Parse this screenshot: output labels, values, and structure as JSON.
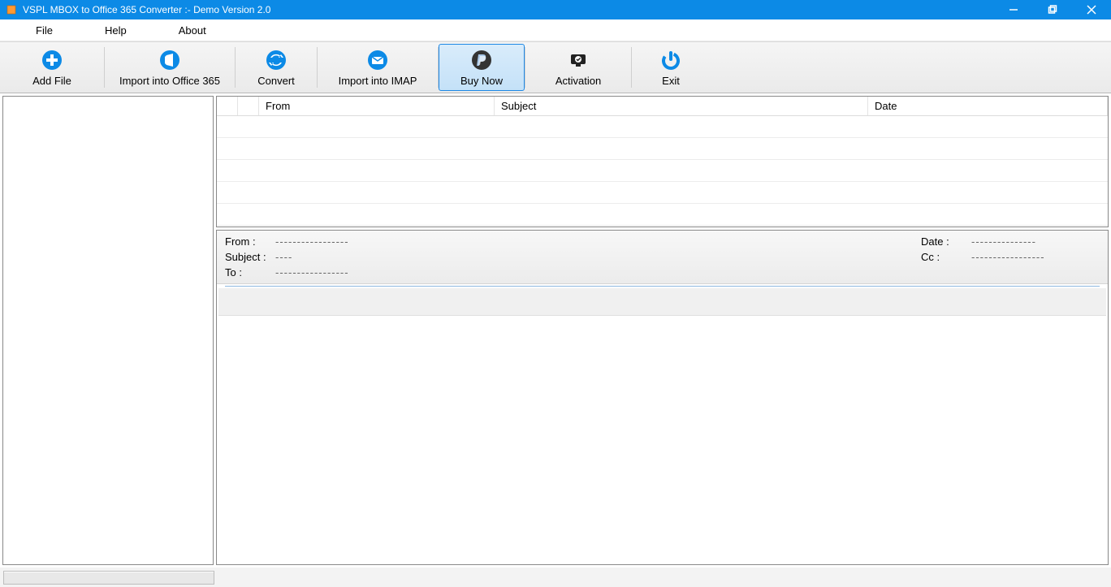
{
  "window": {
    "title": "VSPL MBOX to Office 365 Converter  :- Demo Version 2.0"
  },
  "menu": {
    "items": [
      {
        "label": "File"
      },
      {
        "label": "Help"
      },
      {
        "label": "About"
      }
    ]
  },
  "toolbar": {
    "add_file": "Add File",
    "import_o365": "Import into Office 365",
    "convert": "Convert",
    "import_imap": "Import into IMAP",
    "buy_now": "Buy Now",
    "activation": "Activation",
    "exit": "Exit"
  },
  "list": {
    "headers": {
      "from": "From",
      "subject": "Subject",
      "date": "Date"
    }
  },
  "preview": {
    "from_label": "From :",
    "subject_label": "Subject :",
    "to_label": "To :",
    "date_label": "Date :",
    "cc_label": "Cc :",
    "from_val": "-----------------",
    "subject_val": "----",
    "to_val": "-----------------",
    "date_val": "---------------",
    "cc_val": "-----------------"
  }
}
